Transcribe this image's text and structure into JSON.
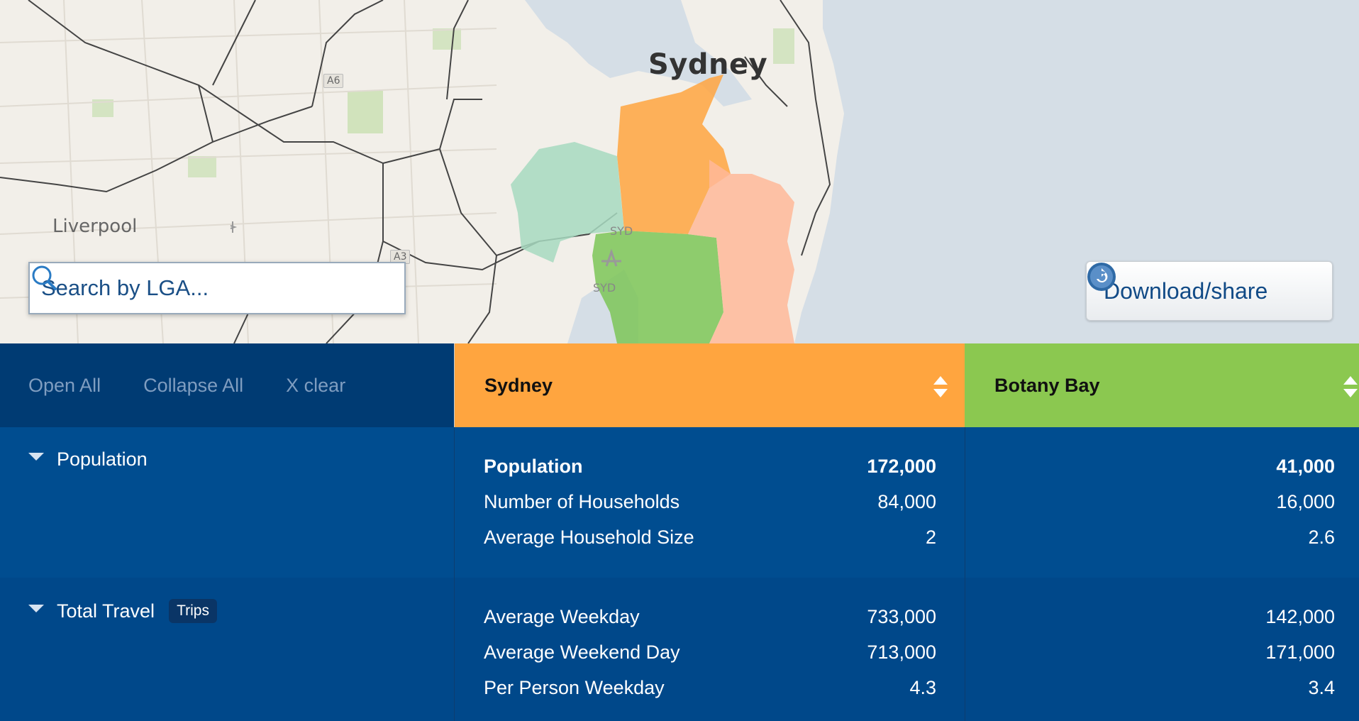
{
  "map": {
    "city_label": "Sydney",
    "suburb_label": "Liverpool",
    "road_a6": "A6",
    "road_a3": "A3",
    "airport_code_1": "SYD",
    "airport_code_2": "SYD"
  },
  "search": {
    "placeholder": "Search by LGA...",
    "icon": "search-icon"
  },
  "download": {
    "label": "Download/share",
    "icon": "share-icon"
  },
  "toolbar": {
    "open_all": "Open All",
    "collapse_all": "Collapse All",
    "clear": "X clear"
  },
  "columns": [
    {
      "name": "Sydney",
      "color": "#ffa53f"
    },
    {
      "name": "Botany Bay",
      "color": "#8bc850"
    }
  ],
  "sections": {
    "population": {
      "label": "Population",
      "rows": [
        {
          "label": "Population",
          "sydney": "172,000",
          "botany": "41,000"
        },
        {
          "label": "Number of Households",
          "sydney": "84,000",
          "botany": "16,000"
        },
        {
          "label": "Average Household Size",
          "sydney": "2",
          "botany": "2.6"
        }
      ]
    },
    "travel": {
      "label": "Total Travel",
      "badge": "Trips",
      "rows": [
        {
          "label": "Average Weekday",
          "sydney": "733,000",
          "botany": "142,000"
        },
        {
          "label": "Average Weekend Day",
          "sydney": "713,000",
          "botany": "171,000"
        },
        {
          "label": "Per Person Weekday",
          "sydney": "4.3",
          "botany": "3.4"
        }
      ]
    }
  }
}
